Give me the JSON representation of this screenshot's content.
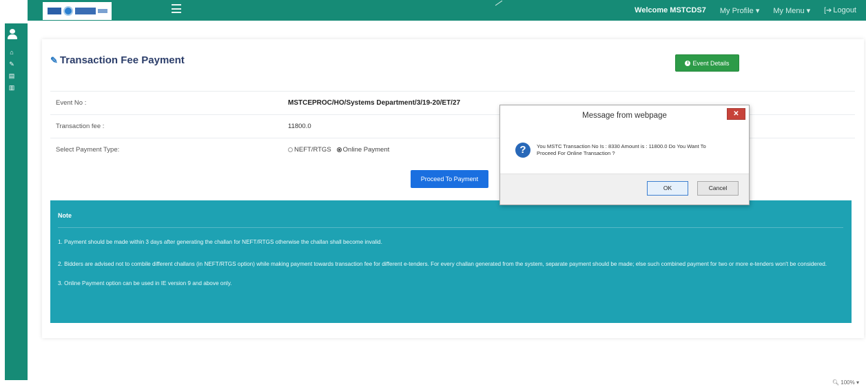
{
  "topbar": {
    "welcome": "Welcome MSTCDS7",
    "my_profile": "My Profile ▾",
    "my_menu": "My Menu ▾",
    "logout": "Logout"
  },
  "page": {
    "title": "Transaction Fee Payment",
    "event_details_button": "Event Details"
  },
  "form": {
    "event_no_label": "Event No :",
    "event_no_value": "MSTCEPROC/HO/Systems Department/3/19-20/ET/27",
    "fee_label": "Transaction fee :",
    "fee_value": "11800.0",
    "payment_type_label": "Select Payment Type:",
    "payment_options": [
      "NEFT/RTGS",
      "Online Payment"
    ],
    "selected_option": "Online Payment",
    "proceed_button": "Proceed To Payment"
  },
  "note": {
    "title": "Note",
    "items": [
      "1. Payment should be made within 3 days after generating the challan for NEFT/RTGS otherwise the challan shall become invalid.",
      "2. Bidders are advised not to combile different challans (in NEFT/RTGS option) while making payment towards transaction fee for different e-tenders. For every challan generated from the system, separate payment should be made; else such combined payment for two or more e-tenders won't be considered.",
      "3. Online Payment option can be used in IE version 9 and above only."
    ]
  },
  "dialog": {
    "title": "Message from webpage",
    "message": "You MSTC Transaction No Is : 8330 Amount is : 11800.0 Do You Want To Proceed For Online Transaction ?",
    "ok": "OK",
    "cancel": "Cancel"
  },
  "status": {
    "zoom": "100%"
  },
  "colors": {
    "brand_green": "#168b76",
    "note_teal": "#1ea2b3",
    "proceed_blue": "#1a6fe0",
    "event_green": "#2d9b48"
  }
}
